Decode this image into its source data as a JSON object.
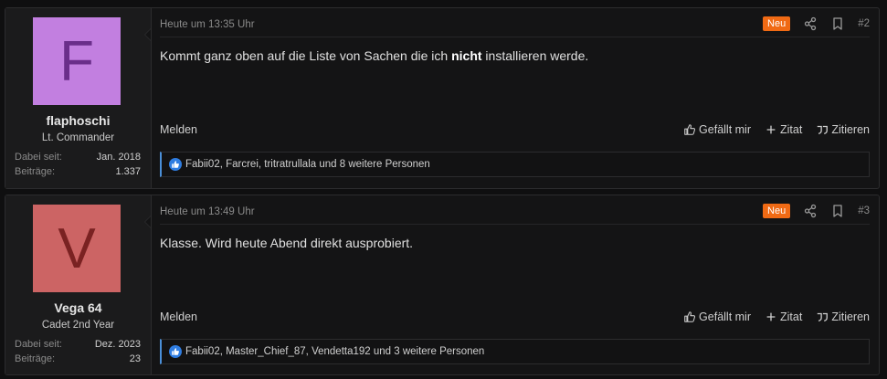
{
  "posts": [
    {
      "avatar_letter": "F",
      "avatar_bg": "#c27fe0",
      "avatar_fg": "#6a2e8a",
      "username": "flaphoschi",
      "user_title": "Lt. Commander",
      "stats": [
        {
          "label": "Dabei seit:",
          "value": "Jan. 2018"
        },
        {
          "label": "Beiträge:",
          "value": "1.337"
        }
      ],
      "timestamp": "Heute um 13:35 Uhr",
      "badge": "Neu",
      "post_number": "#2",
      "body_before": "Kommt ganz oben auf die Liste von Sachen die ich ",
      "body_bold": "nicht",
      "body_after": " installieren werde.",
      "report_label": "Melden",
      "like_label": "Gefällt mir",
      "quote_plus_label": "Zitat",
      "quote_label": "Zitieren",
      "reactions_text": "Fabii02, Farcrei, tritratrullala und 8 weitere Personen"
    },
    {
      "avatar_letter": "V",
      "avatar_bg": "#cc6464",
      "avatar_fg": "#7a2222",
      "username": "Vega 64",
      "user_title": "Cadet 2nd Year",
      "stats": [
        {
          "label": "Dabei seit:",
          "value": "Dez. 2023"
        },
        {
          "label": "Beiträge:",
          "value": "23"
        }
      ],
      "timestamp": "Heute um 13:49 Uhr",
      "badge": "Neu",
      "post_number": "#3",
      "body_before": "Klasse. Wird heute Abend direkt ausprobiert.",
      "body_bold": "",
      "body_after": "",
      "report_label": "Melden",
      "like_label": "Gefällt mir",
      "quote_plus_label": "Zitat",
      "quote_label": "Zitieren",
      "reactions_text": "Fabii02, Master_Chief_87, Vendetta192 und 3 weitere Personen"
    }
  ],
  "colors": {
    "badge": "#f06a14",
    "like_blue": "#2f7de1",
    "reaction_accent": "#4a8fd8"
  },
  "icons": [
    "share-icon",
    "bookmark-icon",
    "thumbs-up-icon",
    "plus-icon",
    "quote-icon",
    "like-reaction-icon"
  ]
}
